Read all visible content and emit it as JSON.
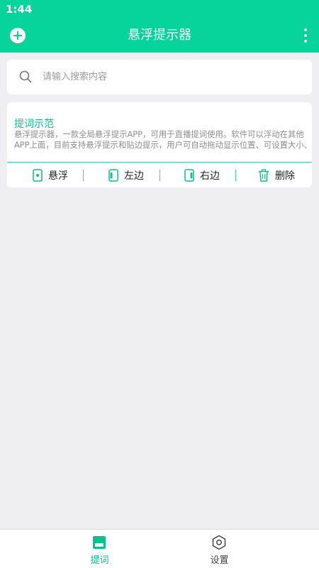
{
  "status_bar": {
    "time": "1:44"
  },
  "app_bar": {
    "title": "悬浮提示器",
    "add_icon": "plus-circle-icon",
    "more_icon": "more-vert-icon"
  },
  "search": {
    "placeholder": "请输入搜索内容",
    "value": "",
    "icon": "search-icon"
  },
  "cards": [
    {
      "title": "提词示范",
      "description_lines": [
        "悬浮提示器，一款全局悬浮提示APP，可用于直播提词使用。软件可以浮动在其他",
        "APP上面，目前支持悬浮提示和贴边提示，用户可自动拖动显示位置、可设置大小、"
      ],
      "actions": [
        {
          "label": "悬浮",
          "icon": "float-icon"
        },
        {
          "label": "左边",
          "icon": "dock-left-icon"
        },
        {
          "label": "右边",
          "icon": "dock-right-icon"
        },
        {
          "label": "删除",
          "icon": "trash-icon"
        }
      ]
    }
  ],
  "bottom_nav": [
    {
      "label": "提词",
      "icon": "prompt-square-icon",
      "active": true
    },
    {
      "label": "设置",
      "icon": "settings-hexagon-icon",
      "active": false
    }
  ],
  "colors": {
    "accent": "#07d49a",
    "accent_text": "#07c48f",
    "background": "#efeff2",
    "inactive": "#444444"
  }
}
